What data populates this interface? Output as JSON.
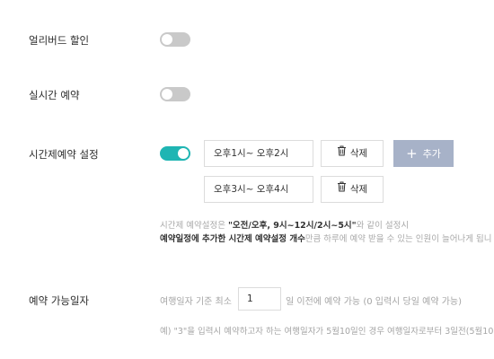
{
  "settings": {
    "early_bird": {
      "label": "얼리버드 할인",
      "enabled": false
    },
    "realtime": {
      "label": "실시간 예약",
      "enabled": false
    },
    "timeslot": {
      "label": "시간제예약 설정",
      "enabled": true,
      "slots": [
        {
          "value": "오후1시~ 오후2시",
          "delete_label": "삭제"
        },
        {
          "value": "오후3시~ 오후4시",
          "delete_label": "삭제"
        }
      ],
      "add_label": "+ 추가",
      "add_text": "추가",
      "note1_prefix": "시간제 예약설정은 ",
      "note1_bold": "\"오전/오후, 9시~12시/2시~5시\"",
      "note1_suffix": "와 같이 설정시",
      "note2_bold": "예약일정에 추가한 시간제 예약설정 개수",
      "note2_rest": "만큼 하루에 예약 받을 수 있는 인원이 늘어나게 됩니"
    },
    "available_days": {
      "label": "예약 가능일자",
      "prefix": "여행일자 기준 최소",
      "value": "1",
      "suffix": "일 이전에 예약 가능 (0 입력시 당일 예약 가능)",
      "example": "예) \"3\"을 입력시 예약하고자 하는 여행일자가 5월10일인 경우 여행일자로부터 3일전(5월10"
    }
  }
}
